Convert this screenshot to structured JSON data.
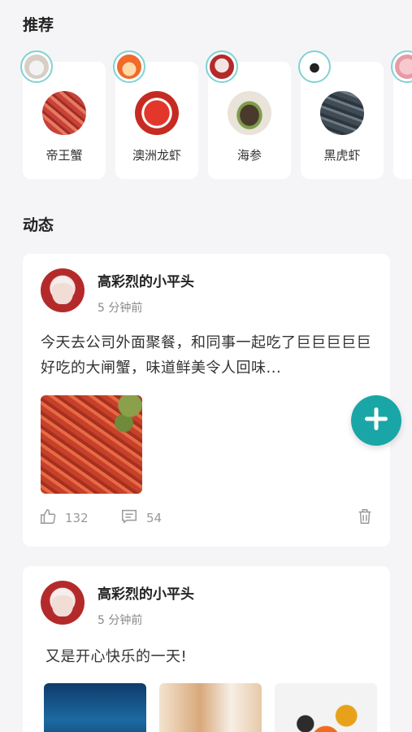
{
  "recommend": {
    "title": "推荐",
    "items": [
      {
        "label": "帝王蟹",
        "thumb_color": "#c8423a",
        "avatar_icon": "dog-avatar"
      },
      {
        "label": "澳洲龙虾",
        "thumb_color": "#c52b22",
        "avatar_icon": "cartoon-avatar"
      },
      {
        "label": "海参",
        "thumb_color": "#5b4636",
        "avatar_icon": "anime-girl-avatar"
      },
      {
        "label": "黑虎虾",
        "thumb_color": "#4b5a66",
        "avatar_icon": "penguin-avatar"
      },
      {
        "label": "",
        "thumb_color": "#eeeeee",
        "avatar_icon": "pink-avatar"
      }
    ]
  },
  "feed": {
    "title": "动态",
    "posts": [
      {
        "name": "高彩烈的小平头",
        "time": "5 分钟前",
        "text": "今天去公司外面聚餐，和同事一起吃了巨巨巨巨巨好吃的大闸蟹，味道鲜美令人回味...",
        "likes": "132",
        "comments": "54"
      },
      {
        "name": "高彩烈的小平头",
        "time": "5 分钟前",
        "text": "又是开心快乐的一天!"
      }
    ]
  },
  "colors": {
    "accent": "#1aa6a6",
    "avatar_ring": "#7fd3d3",
    "background": "#f5f5f7"
  }
}
